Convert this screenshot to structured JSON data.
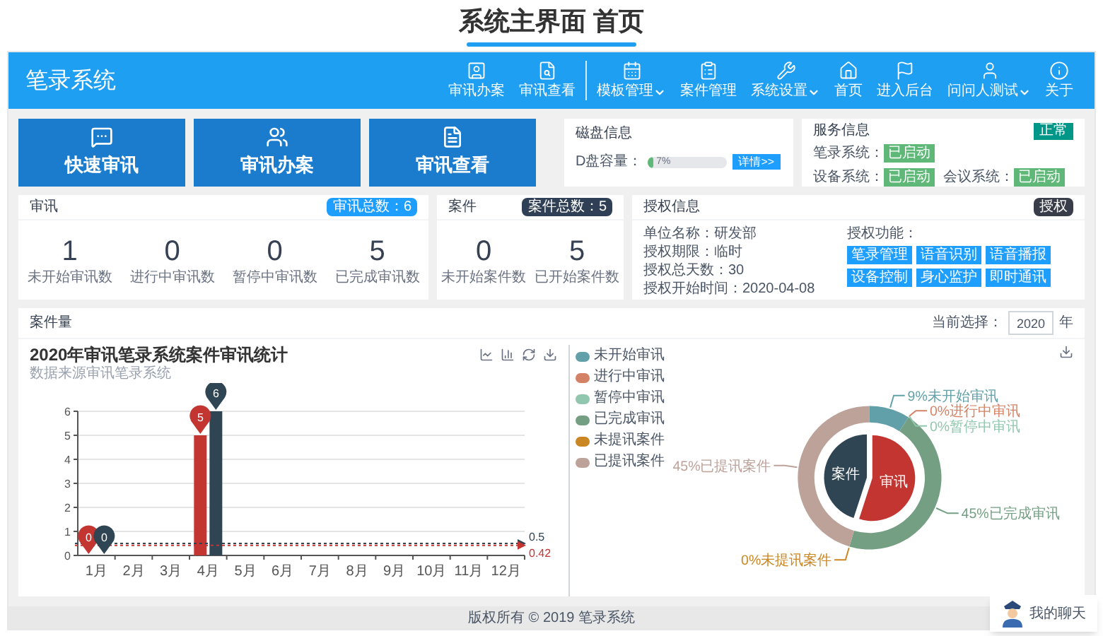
{
  "page_title": "系统主界面 首页",
  "app": {
    "title": "笔录系统",
    "nav": [
      {
        "label": "审讯办案",
        "menu": false,
        "separator": false
      },
      {
        "label": "审讯查看",
        "menu": false,
        "separator": true
      },
      {
        "label": "模板管理",
        "menu": true,
        "separator": false
      },
      {
        "label": "案件管理",
        "menu": false,
        "separator": false
      },
      {
        "label": "系统设置",
        "menu": true,
        "separator": false
      },
      {
        "label": "首页",
        "menu": false,
        "separator": false
      },
      {
        "label": "进入后台",
        "menu": false,
        "separator": false
      },
      {
        "label": "问问人测试",
        "menu": true,
        "separator": false
      },
      {
        "label": "关于",
        "menu": false,
        "separator": false
      }
    ]
  },
  "quick_actions": [
    "快速审讯",
    "审讯办案",
    "审讯查看"
  ],
  "disk": {
    "title": "磁盘信息",
    "label": "D盘容量：",
    "level": 0.07,
    "reading": "7%",
    "button": "详情>>"
  },
  "service": {
    "title": "服务信息",
    "badge": "正常",
    "rows": [
      [
        {
          "label": "笔录系统：",
          "status": "已启动"
        }
      ],
      [
        {
          "label": "设备系统：",
          "status": "已启动"
        },
        {
          "label": "会议系统：",
          "status": "已启动"
        }
      ]
    ]
  },
  "interrogation": {
    "title": "审讯",
    "badge": "审讯总数：6",
    "stats": [
      {
        "value": "1",
        "label": "未开始审讯数"
      },
      {
        "value": "0",
        "label": "进行中审讯数"
      },
      {
        "value": "0",
        "label": "暂停中审讯数"
      },
      {
        "value": "5",
        "label": "已完成审讯数"
      }
    ]
  },
  "cases": {
    "title": "案件",
    "badge": "案件总数：5",
    "stats": [
      {
        "value": "0",
        "label": "未开始案件数"
      },
      {
        "value": "5",
        "label": "已开始案件数"
      }
    ]
  },
  "license": {
    "title": "授权信息",
    "badge": "授权",
    "fields": [
      "单位名称：研发部",
      "授权期限：临时",
      "授权总天数：30",
      "授权开始时间：2020-04-08"
    ],
    "features_label": "授权功能：",
    "features": [
      "笔录管理",
      "语音识别",
      "语音播报",
      "设备控制",
      "身心监护",
      "即时通讯"
    ]
  },
  "volume": {
    "title": "案件量",
    "year_label": "当前选择：",
    "year": "2020",
    "year_unit": "年",
    "bar_panel": {
      "chart_data": {
        "type": "bar",
        "title": "2020年审讯笔录系统案件审讯统计",
        "subtitle": "数据来源审讯笔录系统",
        "categories": [
          "1月",
          "2月",
          "3月",
          "4月",
          "5月",
          "6月",
          "7月",
          "8月",
          "9月",
          "10月",
          "11月",
          "12月"
        ],
        "series": [
          {
            "color": "#c23531",
            "values": [
              0,
              0,
              0,
              5,
              0,
              0,
              0,
              0,
              0,
              0,
              0,
              0
            ]
          },
          {
            "color": "#2f4554",
            "values": [
              0,
              0,
              0,
              6,
              0,
              0,
              0,
              0,
              0,
              0,
              0,
              0
            ]
          }
        ],
        "ylim": [
          0,
          6
        ],
        "yticks": [
          {
            "value": 0,
            "label": "0"
          },
          {
            "value": 1,
            "label": "1"
          },
          {
            "value": 2,
            "label": "2"
          },
          {
            "value": 3,
            "label": "3"
          },
          {
            "value": 4,
            "label": "4"
          },
          {
            "value": 5,
            "label": "5"
          },
          {
            "value": 6,
            "label": "6"
          }
        ],
        "grid": true,
        "annotations": [
          {
            "x": "1月",
            "y": 0,
            "text": "0"
          },
          {
            "x": "1月",
            "y": 0,
            "text": "0"
          },
          {
            "x": "4月",
            "y": 5,
            "text": "5"
          },
          {
            "x": "4月",
            "y": 6,
            "text": "6"
          }
        ],
        "ref_lines": [
          {
            "axis": "y",
            "value": 0.5,
            "label": "0.5"
          },
          {
            "axis": "y",
            "value": 0.42,
            "label": "0.42"
          }
        ]
      }
    },
    "ring_panel": {
      "chart_data": {
        "type": "donut",
        "categories": [
          "未开始审讯",
          "进行中审讯",
          "暂停中审讯",
          "已完成审讯",
          "未提讯案件",
          "已提讯案件"
        ],
        "values": [
          9,
          0,
          0,
          45,
          0,
          45
        ],
        "legend": "upper left",
        "colors": [
          "#61a0a8",
          "#d48265",
          "#91c7ae",
          "#749f83",
          "#ca8622",
          "#bda29a"
        ],
        "value_labels": [
          "9%未开始审讯",
          "0%进行中审讯",
          "0%暂停中审讯",
          "45%已完成审讯",
          "0%未提讯案件",
          "45%已提讯案件"
        ]
      }
    },
    "pie_panel": {
      "chart_data": {
        "type": "pie",
        "categories": [
          "审讯",
          "案件"
        ],
        "values": [
          55,
          45
        ],
        "colors": [
          "#c23531",
          "#2f4554"
        ]
      }
    }
  },
  "footer": "版权所有 © 2019 笔录系统",
  "chat": {
    "label": "我的聊天"
  }
}
